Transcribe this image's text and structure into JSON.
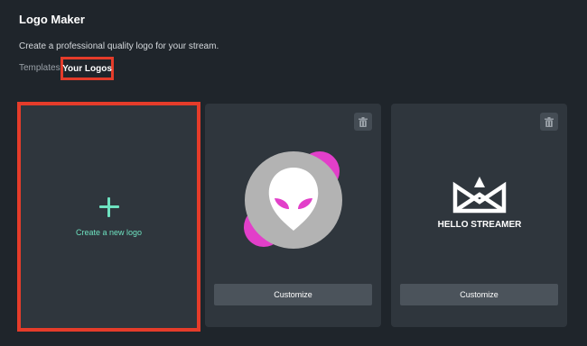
{
  "header": {
    "title": "Logo Maker",
    "subtitle": "Create a professional quality logo for your stream."
  },
  "tabs": [
    {
      "label": "Templates",
      "active": false
    },
    {
      "label": "Your Logos",
      "active": true
    }
  ],
  "cards": {
    "new_logo": {
      "label": "Create a new logo",
      "icon": "plus-icon"
    },
    "logos": [
      {
        "icon": "alien-head-icon",
        "delete_icon": "trash-icon",
        "customize_label": "Customize"
      },
      {
        "icon": "crown-icon",
        "logo_text": "HELLO STREAMER",
        "delete_icon": "trash-icon",
        "customize_label": "Customize"
      }
    ]
  },
  "colors": {
    "background": "#1f252b",
    "card": "#2f363d",
    "accent": "#6ee2c0",
    "highlight": "#e53c2a",
    "button": "#4b535b",
    "magenta": "#e23fc9"
  }
}
